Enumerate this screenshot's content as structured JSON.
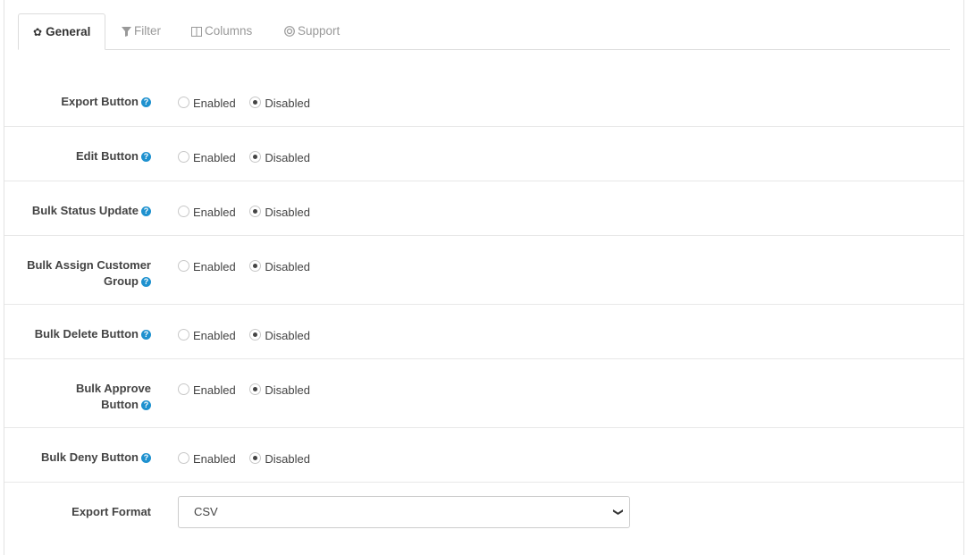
{
  "tabs": [
    {
      "label": "General",
      "icon": "gear-icon",
      "active": true
    },
    {
      "label": "Filter",
      "icon": "filter-icon",
      "active": false
    },
    {
      "label": "Columns",
      "icon": "columns-icon",
      "active": false
    },
    {
      "label": "Support",
      "icon": "lifebuoy-icon",
      "active": false
    }
  ],
  "options": {
    "enabled": "Enabled",
    "disabled": "Disabled"
  },
  "settings": [
    {
      "label": "Export Button",
      "value": "Disabled"
    },
    {
      "label": "Edit Button",
      "value": "Disabled"
    },
    {
      "label": "Bulk Status Update",
      "value": "Disabled"
    },
    {
      "label_line1": "Bulk Assign Customer",
      "label_line2": "Group",
      "value": "Disabled"
    },
    {
      "label": "Bulk Delete Button",
      "value": "Disabled"
    },
    {
      "label_line1": "Bulk Approve",
      "label_line2": "Button",
      "value": "Disabled"
    },
    {
      "label": "Bulk Deny Button",
      "value": "Disabled"
    }
  ],
  "export_format": {
    "label": "Export Format",
    "value": "CSV"
  },
  "help_glyph": "?",
  "colors": {
    "help_icon": "#1e91cf",
    "border": "#e8e8e8"
  }
}
